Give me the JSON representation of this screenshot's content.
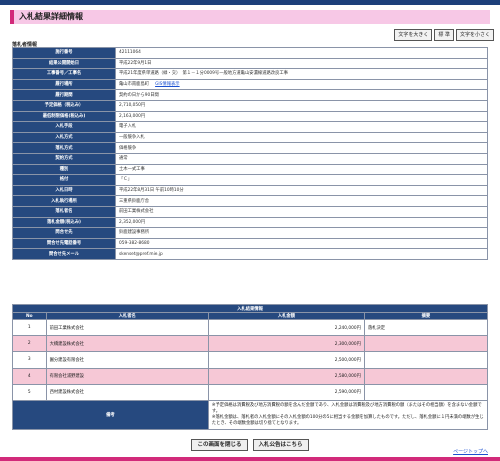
{
  "page": {
    "title": "入札結果詳細情報",
    "section_label": "落札者情報"
  },
  "font_controls": {
    "larger": "文字を大きく",
    "standard": "標 準",
    "smaller": "文字を小さく"
  },
  "info_rows": [
    {
      "label": "施行番号",
      "value": "42111064"
    },
    {
      "label": "結果公開開始日",
      "value": "平成22年9月1日"
    },
    {
      "label": "工事番号／工事名",
      "value": "平成21年度県単道路（緑・交）　第１－１分0009号一般地方道亀山安濃線道路改良工事"
    },
    {
      "label": "履行場所",
      "value": "亀山市南鹿島町",
      "link": "GIS情報表示"
    },
    {
      "label": "履行期間",
      "value": "契約の日から90日間"
    },
    {
      "label": "予定価格（税込み）",
      "value": "2,710,050円"
    },
    {
      "label": "最低制限価格(税込み)",
      "value": "2,163,000円"
    },
    {
      "label": "入札手段",
      "value": "電子入札"
    },
    {
      "label": "入札方式",
      "value": "一般競争入札"
    },
    {
      "label": "落札方式",
      "value": "価格競争"
    },
    {
      "label": "契約方式",
      "value": "通常"
    },
    {
      "label": "種別",
      "value": "土木一式工事"
    },
    {
      "label": "格付",
      "value": "「Ｃ」"
    },
    {
      "label": "入札日時",
      "value": "平成22年8月31日 午前10時10分"
    },
    {
      "label": "入札執行場所",
      "value": "三重県鈴鹿庁舎"
    },
    {
      "label": "落札者名",
      "value": "前田工業株式会社"
    },
    {
      "label": "落札金額(税込み)",
      "value": "2,352,000円"
    },
    {
      "label": "問合せ先",
      "value": "鈴鹿建設事務所"
    },
    {
      "label": "問合せ先電話番号",
      "value": "059-382-8680"
    },
    {
      "label": "問合せ先メール",
      "value": "skenset@pref.mie.jp"
    }
  ],
  "results": {
    "caption": "入札結果情報",
    "headers": [
      "No",
      "入札者名",
      "入札金額",
      "摘要"
    ],
    "rows": [
      {
        "no": "1",
        "name": "前田工業株式会社",
        "amount": "2,240,000円",
        "note": "落札決定"
      },
      {
        "no": "2",
        "name": "大橋建設株式会社",
        "amount": "2,300,000円",
        "note": ""
      },
      {
        "no": "3",
        "name": "園分建設有限会社",
        "amount": "2,500,000円",
        "note": ""
      },
      {
        "no": "4",
        "name": "有限会社浦野建設",
        "amount": "2,580,000円",
        "note": ""
      },
      {
        "no": "5",
        "name": "西村建設株式会社",
        "amount": "2,590,000円",
        "note": ""
      }
    ],
    "note_label": "備考",
    "note_text": "※予定価格は消費税及び地方消費税の額を含んだ金額であり、入札金額は消費税及び地方消費税の額（またはその相当額）を含まない金額です。\n※落札金額は、落札者の入札金額にその入札金額の100分の5に相当する金額を加算したものです。ただし、落札金額に１円未満の端数が生じたとき、その端数金額は切り捨てとなります。"
  },
  "buttons": {
    "close": "この画面を閉じる",
    "notice": "入札公告はこちら"
  },
  "page_top_link": "ページトップへ",
  "colors": {
    "header_navy": "#26497f",
    "title_pink": "#f7c8e6",
    "accent_magenta": "#d22a7a",
    "row_pink": "#f6c8d6"
  }
}
